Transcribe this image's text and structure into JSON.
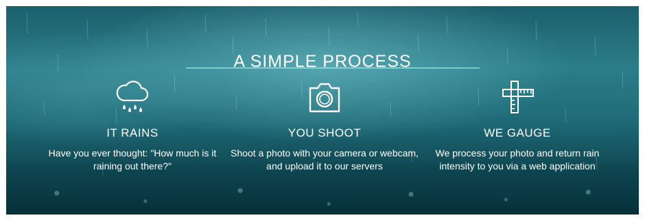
{
  "section": {
    "title": "A SIMPLE PROCESS"
  },
  "steps": [
    {
      "icon": "cloud-rain-icon",
      "heading": "IT RAINS",
      "description": "Have you ever thought: \"How much is it raining out there?\""
    },
    {
      "icon": "camera-icon",
      "heading": "YOU SHOOT",
      "description": "Shoot a photo with your camera or webcam, and upload it to our servers"
    },
    {
      "icon": "ruler-gauge-icon",
      "heading": "WE GAUGE",
      "description": "We process your photo and return rain intensity to you via a web application"
    }
  ],
  "colors": {
    "background_teal": "#1f6a77",
    "text": "#ffffff"
  }
}
